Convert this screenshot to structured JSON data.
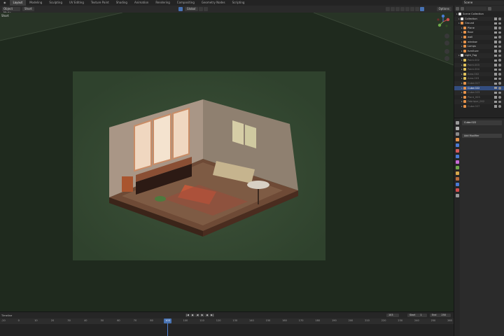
{
  "workspace_tabs": [
    "Layout",
    "Modeling",
    "Sculpting",
    "UV Editing",
    "Texture Paint",
    "Shading",
    "Animation",
    "Rendering",
    "Compositing",
    "Geometry Nodes",
    "Scripting"
  ],
  "scene_name": "Scene",
  "viewport": {
    "mode": "Object Mode",
    "view_label": "Short",
    "transform_orientation": "Global",
    "options_label": "Options"
  },
  "outliner": {
    "rows": [
      {
        "label": "Scene Collection",
        "kind": "collection",
        "state": "normal"
      },
      {
        "label": "Collection",
        "kind": "collection",
        "state": "normal"
      },
      {
        "label": "Ground",
        "kind": "mesh",
        "state": "normal"
      },
      {
        "label": "Plane",
        "kind": "mesh",
        "state": "normal"
      },
      {
        "label": "floor",
        "kind": "mesh",
        "state": "normal"
      },
      {
        "label": "wall",
        "kind": "mesh",
        "state": "normal"
      },
      {
        "label": "window",
        "kind": "mesh",
        "state": "normal"
      },
      {
        "label": "Lamps",
        "kind": "mesh",
        "state": "normal"
      },
      {
        "label": "furniture",
        "kind": "mesh",
        "state": "normal"
      },
      {
        "label": "Light_Fog",
        "kind": "collection",
        "state": "normal"
      },
      {
        "label": "Point.002",
        "kind": "light",
        "state": "dim"
      },
      {
        "label": "Point.003",
        "kind": "light",
        "state": "dim"
      },
      {
        "label": "Point.004",
        "kind": "light",
        "state": "dim"
      },
      {
        "label": "Area.002",
        "kind": "light",
        "state": "dim"
      },
      {
        "label": "Area.003",
        "kind": "light",
        "state": "dim"
      },
      {
        "label": "Cube.017",
        "kind": "mesh",
        "state": "dim"
      },
      {
        "label": "Cube.022",
        "kind": "mesh",
        "state": "selected"
      },
      {
        "label": "Cube.023",
        "kind": "mesh",
        "state": "dim"
      },
      {
        "label": "Plant_003",
        "kind": "mesh",
        "state": "dim"
      },
      {
        "label": "Fabrique_002",
        "kind": "mesh",
        "state": "dim"
      },
      {
        "label": "Cube.027",
        "kind": "mesh",
        "state": "dim"
      }
    ]
  },
  "properties": {
    "object_name": "Cube.022",
    "add_modifier": "Add Modifier"
  },
  "timeline": {
    "label": "Timeline",
    "current_frame": "103",
    "start_label": "Start",
    "start_value": "1",
    "end_label": "End",
    "end_value": "250",
    "ruler_ticks": [
      "-20",
      "0",
      "10",
      "20",
      "30",
      "40",
      "50",
      "60",
      "70",
      "80",
      "90",
      "100",
      "110",
      "120",
      "130",
      "140",
      "150",
      "160",
      "170",
      "180",
      "190",
      "200",
      "210",
      "220",
      "230",
      "240",
      "250",
      "260"
    ]
  },
  "colors": {
    "accent": "#4772b3",
    "viewport_bg": "#1f2a1e",
    "camera_frame": "#334631"
  }
}
